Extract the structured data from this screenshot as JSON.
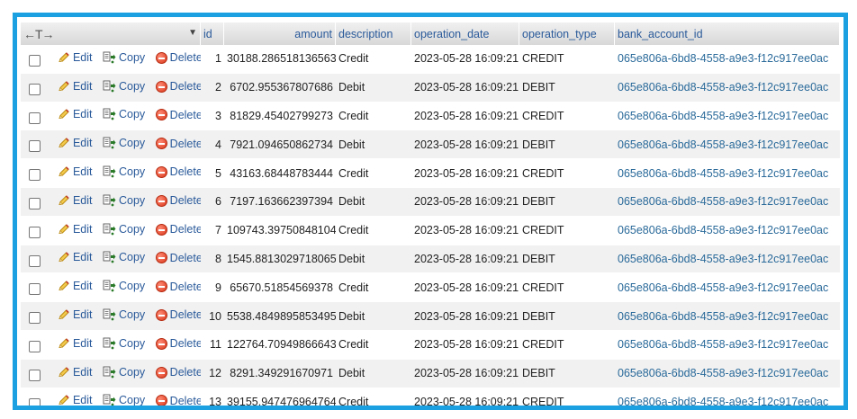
{
  "header": {
    "arrows": "←T→",
    "sort_icon": "triangle-down",
    "columns": [
      "id",
      "amount",
      "description",
      "operation_date",
      "operation_type",
      "bank_account_id"
    ]
  },
  "actions": {
    "edit": "Edit",
    "copy": "Copy",
    "delete": "Delete"
  },
  "colors": {
    "frame": "#1ba1e2",
    "link": "#2a5a9a",
    "header_bg": "#e4e4e4",
    "row_alt": "#f1f1f1"
  },
  "rows": [
    {
      "id": "1",
      "amount": "30188.286518136563",
      "description": "Credit",
      "operation_date": "2023-05-28 16:09:21",
      "operation_type": "CREDIT",
      "bank_account_id": "065e806a-6bd8-4558-a9e3-f12c917ee0ac"
    },
    {
      "id": "2",
      "amount": "6702.955367807686",
      "description": "Debit",
      "operation_date": "2023-05-28 16:09:21",
      "operation_type": "DEBIT",
      "bank_account_id": "065e806a-6bd8-4558-a9e3-f12c917ee0ac"
    },
    {
      "id": "3",
      "amount": "81829.45402799273",
      "description": "Credit",
      "operation_date": "2023-05-28 16:09:21",
      "operation_type": "CREDIT",
      "bank_account_id": "065e806a-6bd8-4558-a9e3-f12c917ee0ac"
    },
    {
      "id": "4",
      "amount": "7921.094650862734",
      "description": "Debit",
      "operation_date": "2023-05-28 16:09:21",
      "operation_type": "DEBIT",
      "bank_account_id": "065e806a-6bd8-4558-a9e3-f12c917ee0ac"
    },
    {
      "id": "5",
      "amount": "43163.68448783444",
      "description": "Credit",
      "operation_date": "2023-05-28 16:09:21",
      "operation_type": "CREDIT",
      "bank_account_id": "065e806a-6bd8-4558-a9e3-f12c917ee0ac"
    },
    {
      "id": "6",
      "amount": "7197.163662397394",
      "description": "Debit",
      "operation_date": "2023-05-28 16:09:21",
      "operation_type": "DEBIT",
      "bank_account_id": "065e806a-6bd8-4558-a9e3-f12c917ee0ac"
    },
    {
      "id": "7",
      "amount": "109743.39750848104",
      "description": "Credit",
      "operation_date": "2023-05-28 16:09:21",
      "operation_type": "CREDIT",
      "bank_account_id": "065e806a-6bd8-4558-a9e3-f12c917ee0ac"
    },
    {
      "id": "8",
      "amount": "1545.8813029718065",
      "description": "Debit",
      "operation_date": "2023-05-28 16:09:21",
      "operation_type": "DEBIT",
      "bank_account_id": "065e806a-6bd8-4558-a9e3-f12c917ee0ac"
    },
    {
      "id": "9",
      "amount": "65670.51854569378",
      "description": "Credit",
      "operation_date": "2023-05-28 16:09:21",
      "operation_type": "CREDIT",
      "bank_account_id": "065e806a-6bd8-4558-a9e3-f12c917ee0ac"
    },
    {
      "id": "10",
      "amount": "5538.4849895853495",
      "description": "Debit",
      "operation_date": "2023-05-28 16:09:21",
      "operation_type": "DEBIT",
      "bank_account_id": "065e806a-6bd8-4558-a9e3-f12c917ee0ac"
    },
    {
      "id": "11",
      "amount": "122764.70949866643",
      "description": "Credit",
      "operation_date": "2023-05-28 16:09:21",
      "operation_type": "CREDIT",
      "bank_account_id": "065e806a-6bd8-4558-a9e3-f12c917ee0ac"
    },
    {
      "id": "12",
      "amount": "8291.349291670971",
      "description": "Debit",
      "operation_date": "2023-05-28 16:09:21",
      "operation_type": "DEBIT",
      "bank_account_id": "065e806a-6bd8-4558-a9e3-f12c917ee0ac"
    },
    {
      "id": "13",
      "amount": "39155.947476964764",
      "description": "Credit",
      "operation_date": "2023-05-28 16:09:21",
      "operation_type": "CREDIT",
      "bank_account_id": "065e806a-6bd8-4558-a9e3-f12c917ee0ac"
    }
  ]
}
